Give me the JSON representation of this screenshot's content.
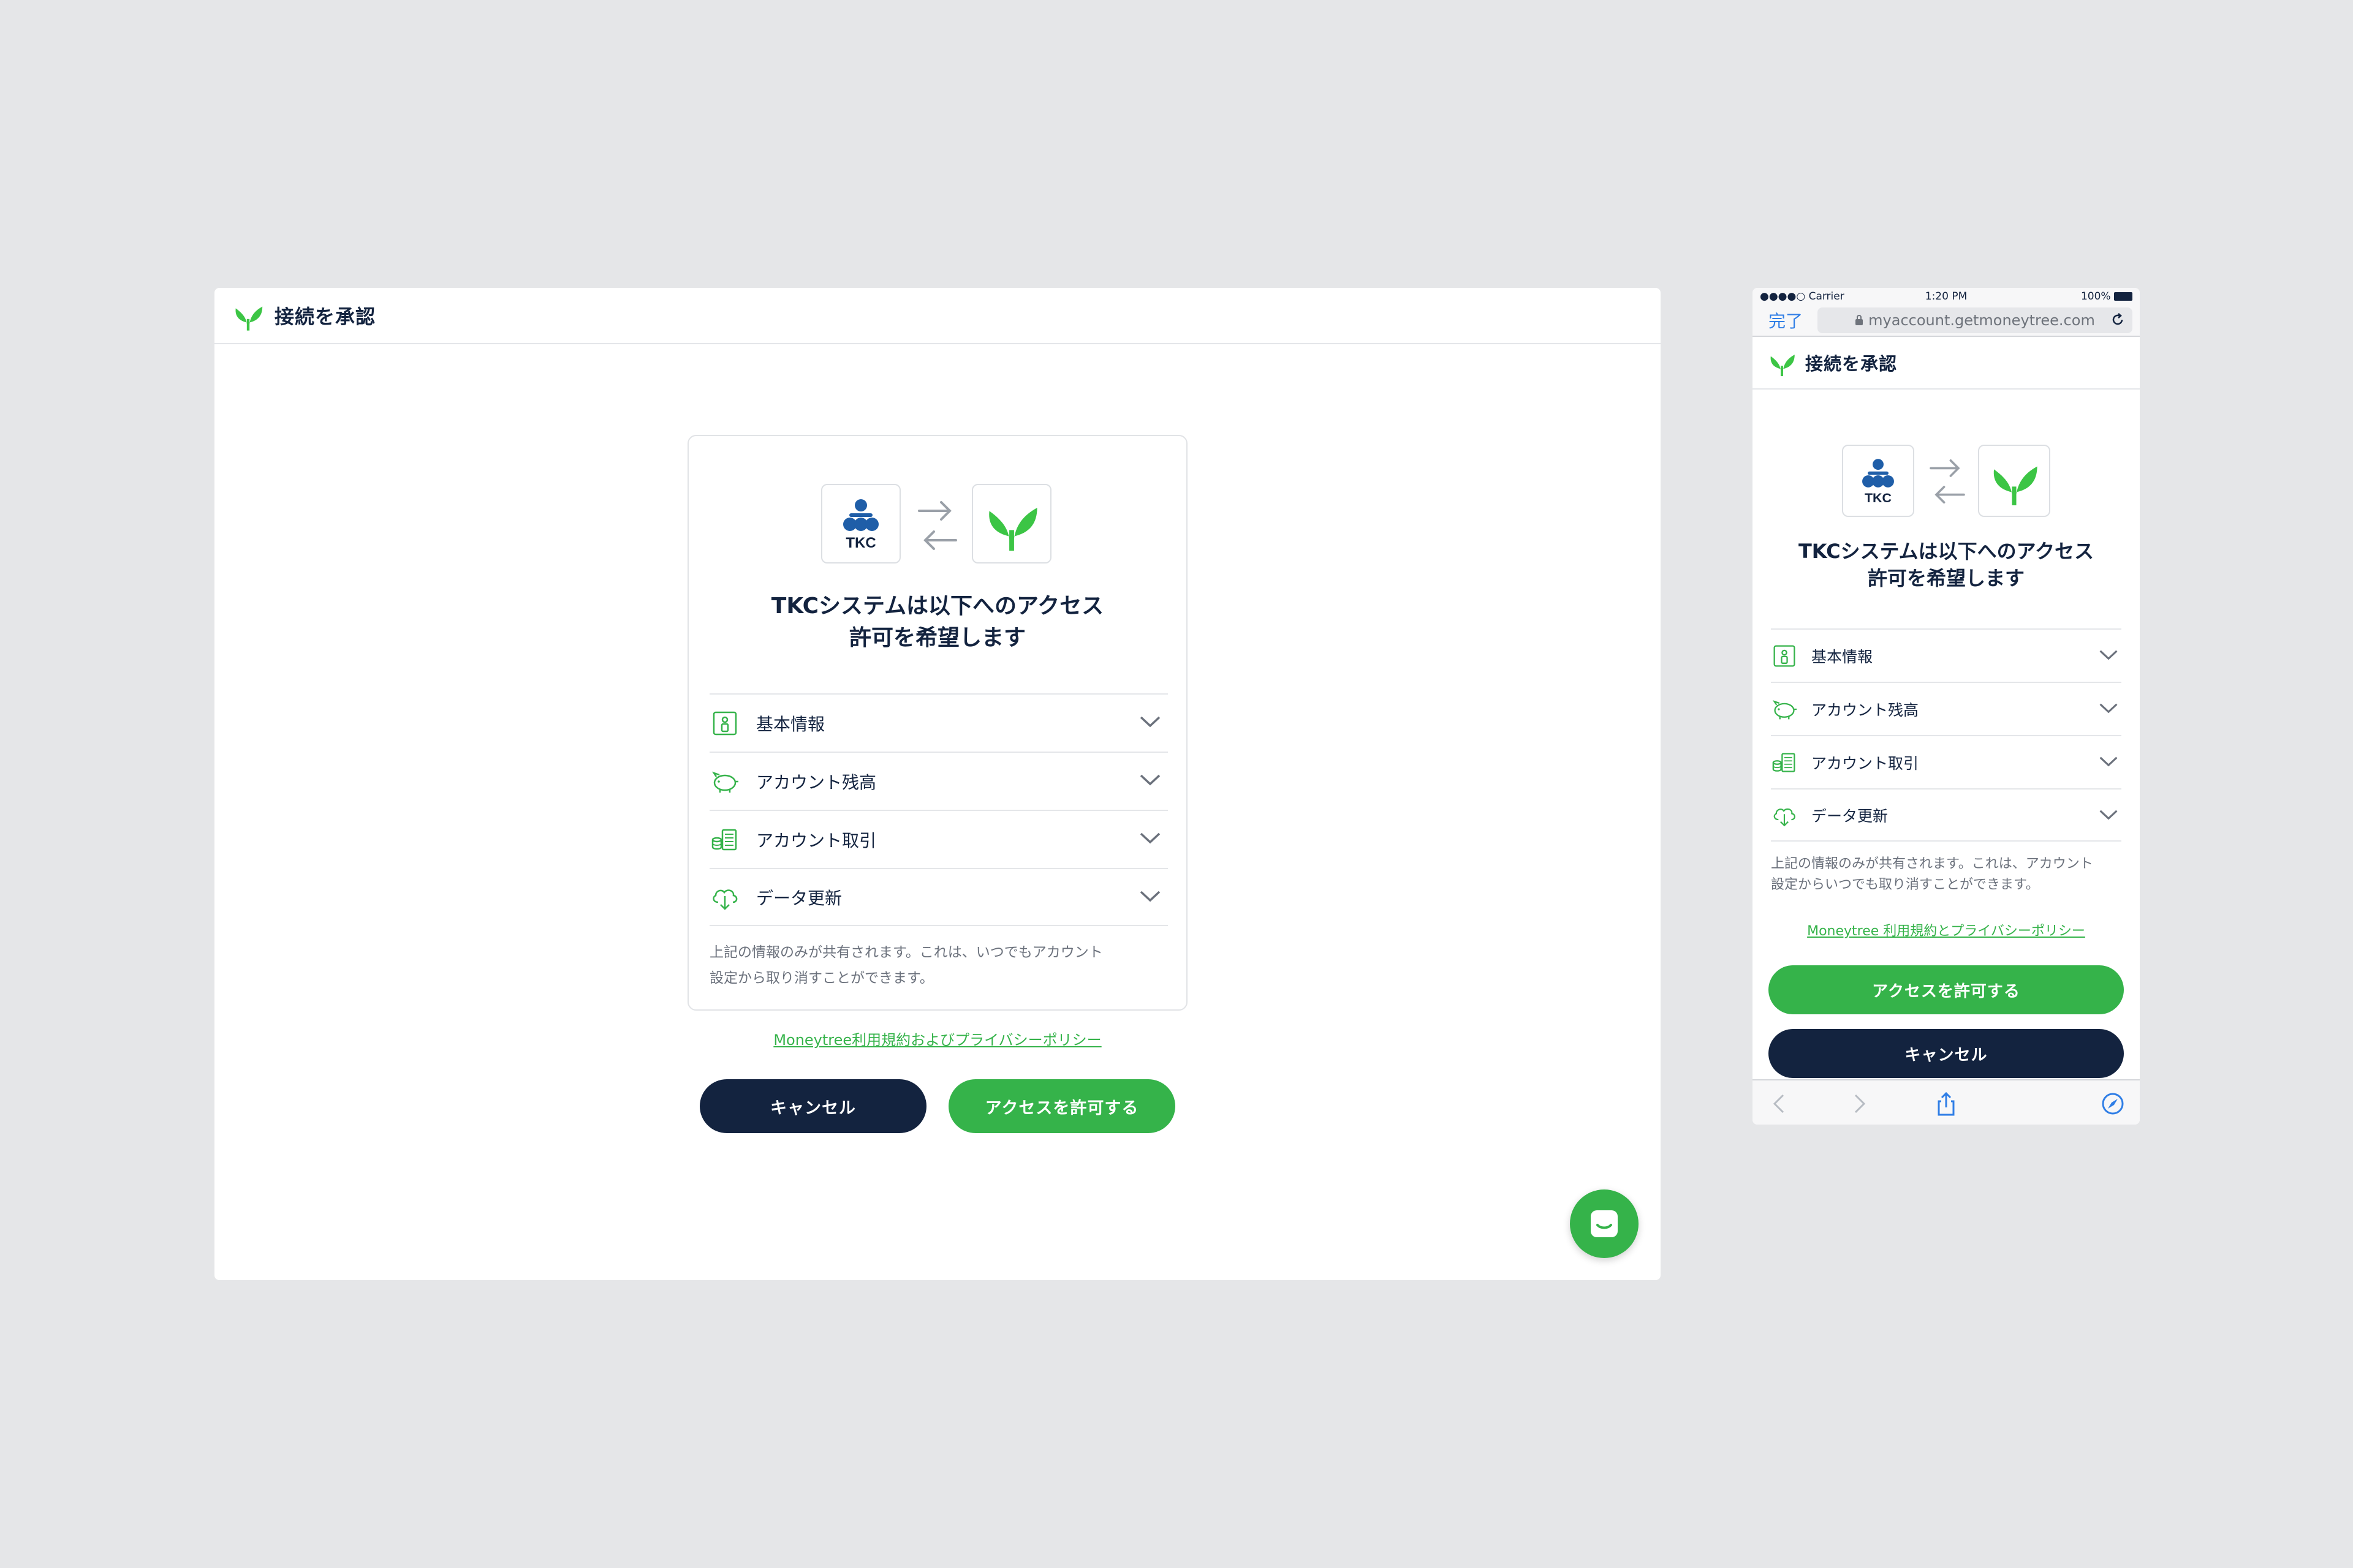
{
  "desktop": {
    "title": "接続を承認",
    "headline_line1": "TKCシステムは以下へのアクセス",
    "headline_line2": "許可を希望します",
    "tkc_label": "TKC",
    "permissions": [
      {
        "label": "基本情報",
        "icon": "id-card-icon"
      },
      {
        "label": "アカウント残高",
        "icon": "piggy-bank-icon"
      },
      {
        "label": "アカウント取引",
        "icon": "transactions-icon"
      },
      {
        "label": "データ更新",
        "icon": "cloud-download-icon"
      }
    ],
    "note_line1": "上記の情報のみが共有されます。これは、いつでもアカウント",
    "note_line2": "設定から取り消すことができます。",
    "terms_link": "Moneytree利用規約およびプライバシーポリシー",
    "cancel_label": "キャンセル",
    "allow_label": "アクセスを許可する"
  },
  "mobile": {
    "status": {
      "carrier": "●●●●○ Carrier",
      "time": "1:20 PM",
      "battery": "100%"
    },
    "browser": {
      "done": "完了",
      "url": "myaccount.getmoneytree.com"
    },
    "title": "接続を承認",
    "headline_line1": "TKCシステムは以下へのアクセス",
    "headline_line2": "許可を希望します",
    "tkc_label": "TKC",
    "permissions": [
      {
        "label": "基本情報",
        "icon": "id-card-icon"
      },
      {
        "label": "アカウント残高",
        "icon": "piggy-bank-icon"
      },
      {
        "label": "アカウント取引",
        "icon": "transactions-icon"
      },
      {
        "label": "データ更新",
        "icon": "cloud-download-icon"
      }
    ],
    "note_line1": "上記の情報のみが共有されます。これは、アカウント",
    "note_line2": "設定からいつでも取り消すことができます。",
    "terms_link": "Moneytree 利用規約とプライバシーポリシー",
    "allow_label": "アクセスを許可する",
    "cancel_label": "キャンセル"
  },
  "colors": {
    "brand_green": "#35b34a",
    "navy": "#13233f",
    "tkc_blue": "#1f5ea8",
    "link_blue": "#2f7ee6"
  }
}
